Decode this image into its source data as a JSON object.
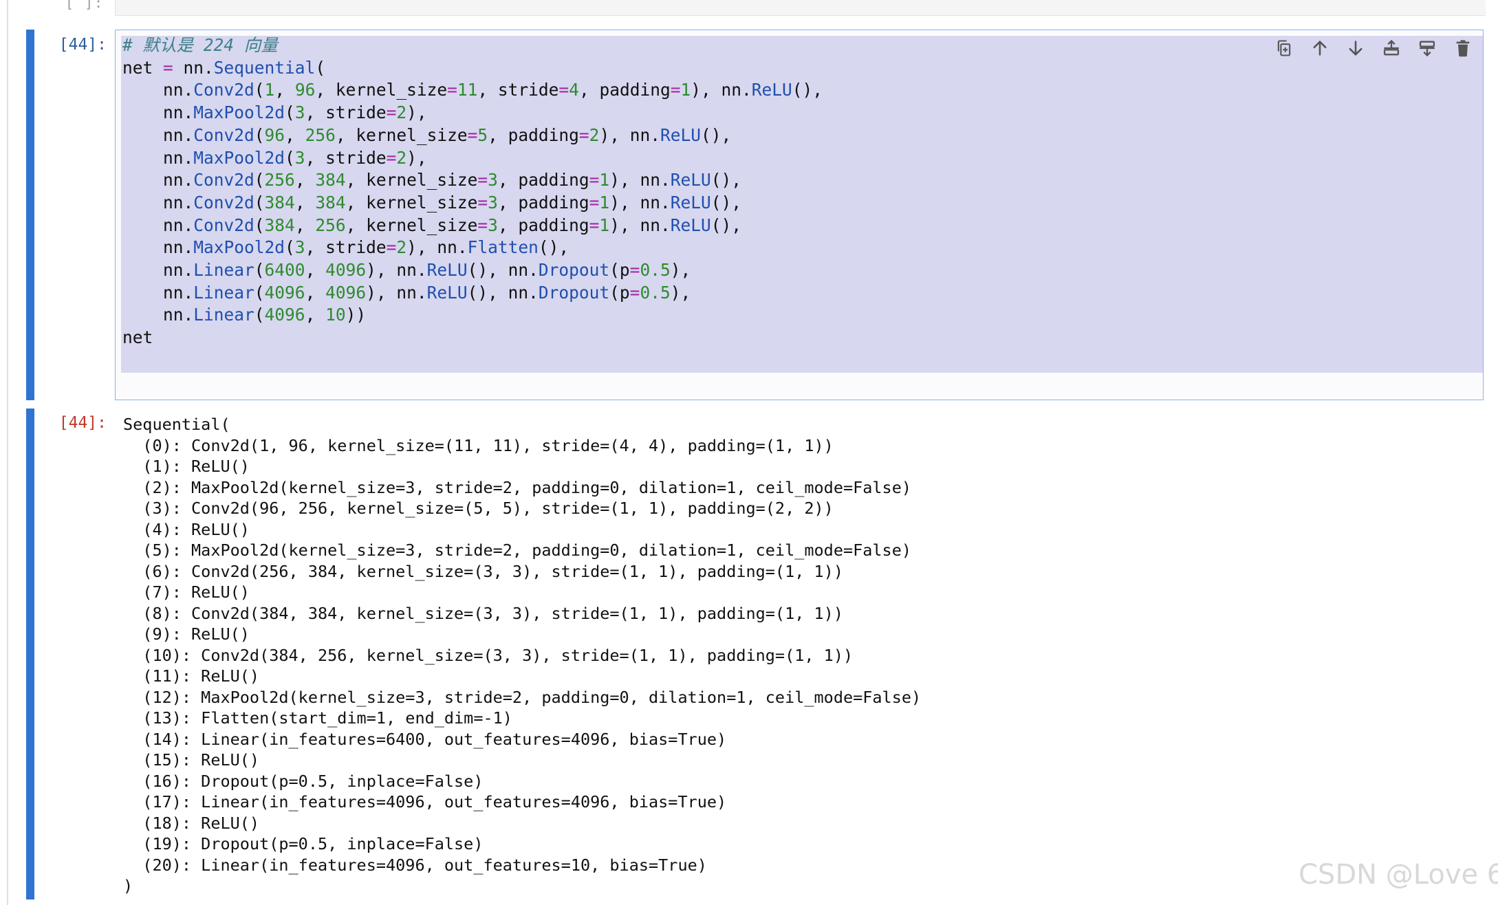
{
  "previous_cell": {
    "prompt": "[ ]:"
  },
  "input_cell": {
    "prompt": "[44]:",
    "comment": "# 默认是 224 向量",
    "toolbar": [
      {
        "name": "duplicate-icon"
      },
      {
        "name": "move-up-icon"
      },
      {
        "name": "move-down-icon"
      },
      {
        "name": "insert-above-icon"
      },
      {
        "name": "insert-below-icon"
      },
      {
        "name": "delete-icon"
      }
    ]
  },
  "output_cell": {
    "prompt": "[44]:",
    "lines": [
      "Sequential(",
      "  (0): Conv2d(1, 96, kernel_size=(11, 11), stride=(4, 4), padding=(1, 1))",
      "  (1): ReLU()",
      "  (2): MaxPool2d(kernel_size=3, stride=2, padding=0, dilation=1, ceil_mode=False)",
      "  (3): Conv2d(96, 256, kernel_size=(5, 5), stride=(1, 1), padding=(2, 2))",
      "  (4): ReLU()",
      "  (5): MaxPool2d(kernel_size=3, stride=2, padding=0, dilation=1, ceil_mode=False)",
      "  (6): Conv2d(256, 384, kernel_size=(3, 3), stride=(1, 1), padding=(1, 1))",
      "  (7): ReLU()",
      "  (8): Conv2d(384, 384, kernel_size=(3, 3), stride=(1, 1), padding=(1, 1))",
      "  (9): ReLU()",
      "  (10): Conv2d(384, 256, kernel_size=(3, 3), stride=(1, 1), padding=(1, 1))",
      "  (11): ReLU()",
      "  (12): MaxPool2d(kernel_size=3, stride=2, padding=0, dilation=1, ceil_mode=False)",
      "  (13): Flatten(start_dim=1, end_dim=-1)",
      "  (14): Linear(in_features=6400, out_features=4096, bias=True)",
      "  (15): ReLU()",
      "  (16): Dropout(p=0.5, inplace=False)",
      "  (17): Linear(in_features=4096, out_features=4096, bias=True)",
      "  (18): ReLU()",
      "  (19): Dropout(p=0.5, inplace=False)",
      "  (20): Linear(in_features=4096, out_features=10, bias=True)",
      ")"
    ]
  },
  "watermark": "CSDN @Love 6",
  "colors": {
    "accent": "#2f74d0",
    "code_bg": "#d7d7ef",
    "function": "#1f4fae",
    "number": "#2e8b2e",
    "operator": "#a52aa5",
    "comment": "#3d7f8a",
    "out_prompt": "#c0392b"
  }
}
